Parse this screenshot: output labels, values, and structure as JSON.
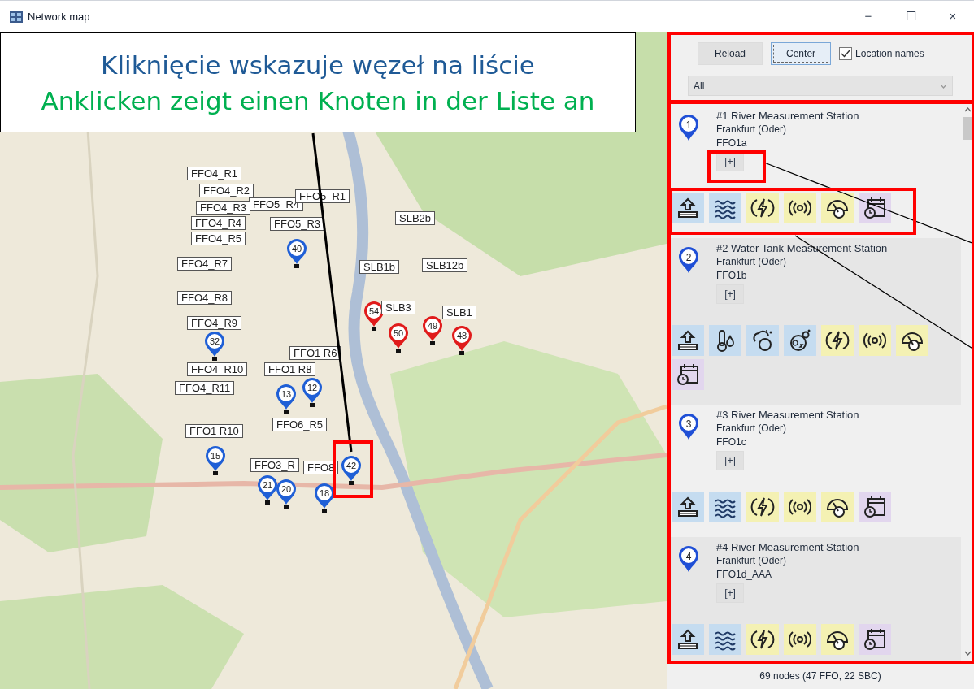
{
  "window": {
    "title": "Network map",
    "controls": [
      "−",
      "☐",
      "×"
    ]
  },
  "callout": {
    "lines": [
      {
        "text": "Kliknięcie wskazuje węzeł na liście",
        "color": "#1f5a96"
      },
      {
        "text": "Anklicken zeigt einen Knoten in der Liste an",
        "color": "#00b050"
      }
    ]
  },
  "map": {
    "pins": [
      {
        "number": "40",
        "color": "#1f5fd6"
      },
      {
        "number": "32",
        "color": "#1f5fd6"
      },
      {
        "number": "13",
        "color": "#1f5fd6"
      },
      {
        "number": "12",
        "color": "#1f5fd6"
      },
      {
        "number": "15",
        "color": "#1f5fd6"
      },
      {
        "number": "21",
        "color": "#1f5fd6"
      },
      {
        "number": "20",
        "color": "#1f5fd6"
      },
      {
        "number": "18",
        "color": "#1f5fd6"
      },
      {
        "number": "42",
        "color": "#1f5fd6"
      },
      {
        "number": "54",
        "color": "#e01b1b"
      },
      {
        "number": "50",
        "color": "#e01b1b"
      },
      {
        "number": "49",
        "color": "#e01b1b"
      },
      {
        "number": "48",
        "color": "#e01b1b"
      }
    ],
    "labels": [
      "FFO4_R1",
      "FFO4_R2",
      "FFO5_R4",
      "FFO4_R3",
      "FFO4_R4",
      "FFO4_R5",
      "FFO4_R7",
      "FFO4_R8",
      "FFO4_R9",
      "FFO4_R10",
      "FFO4_R11",
      "FFO1 R10",
      "FFO5_R1",
      "FFO5_R3",
      "FFO1 R6",
      "FFO1 R8",
      "FFO6_R5",
      "FFO3_R",
      "FFO8",
      "SLB2b",
      "SLB1b",
      "SLB12b",
      "SLB3",
      "SLB1"
    ]
  },
  "panel": {
    "buttons": [
      {
        "label": "Reload",
        "focused": false
      },
      {
        "label": "Center",
        "focused": true
      }
    ],
    "location_names": {
      "label": "Location names",
      "checked": true
    },
    "filter": {
      "value": "All"
    },
    "nodes": [
      {
        "number": "1",
        "title": "#1 River Measurement Station",
        "city": "Frankfurt (Oder)",
        "code": "FFO1a",
        "button": "[+]",
        "sensors": [
          {
            "kind": "level"
          },
          {
            "kind": "waves"
          },
          {
            "kind": "power"
          },
          {
            "kind": "signal"
          },
          {
            "kind": "gauge"
          },
          {
            "kind": "calendar"
          }
        ]
      },
      {
        "number": "2",
        "title": "#2 Water Tank Measurement Station",
        "city": "Frankfurt (Oder)",
        "code": "FFO1b",
        "button": "[+]",
        "sensors": [
          {
            "kind": "level"
          },
          {
            "kind": "thermometer"
          },
          {
            "kind": "weather"
          },
          {
            "kind": "oxygen"
          },
          {
            "kind": "power"
          },
          {
            "kind": "signal"
          },
          {
            "kind": "gauge"
          },
          {
            "kind": "calendar"
          }
        ]
      },
      {
        "number": "3",
        "title": "#3 River Measurement Station",
        "city": "Frankfurt (Oder)",
        "code": "FFO1c",
        "button": "[+]",
        "sensors": [
          {
            "kind": "level"
          },
          {
            "kind": "waves"
          },
          {
            "kind": "power"
          },
          {
            "kind": "signal"
          },
          {
            "kind": "gauge"
          },
          {
            "kind": "calendar"
          }
        ]
      },
      {
        "number": "4",
        "title": "#4 River Measurement Station",
        "city": "Frankfurt (Oder)",
        "code": "FFO1d_AAA",
        "button": "[+]",
        "sensors": [
          {
            "kind": "level"
          },
          {
            "kind": "waves"
          },
          {
            "kind": "power"
          },
          {
            "kind": "signal"
          },
          {
            "kind": "gauge"
          },
          {
            "kind": "calendar"
          }
        ]
      }
    ]
  },
  "status_bar": "69 nodes (47 FFO, 22 SBC)"
}
